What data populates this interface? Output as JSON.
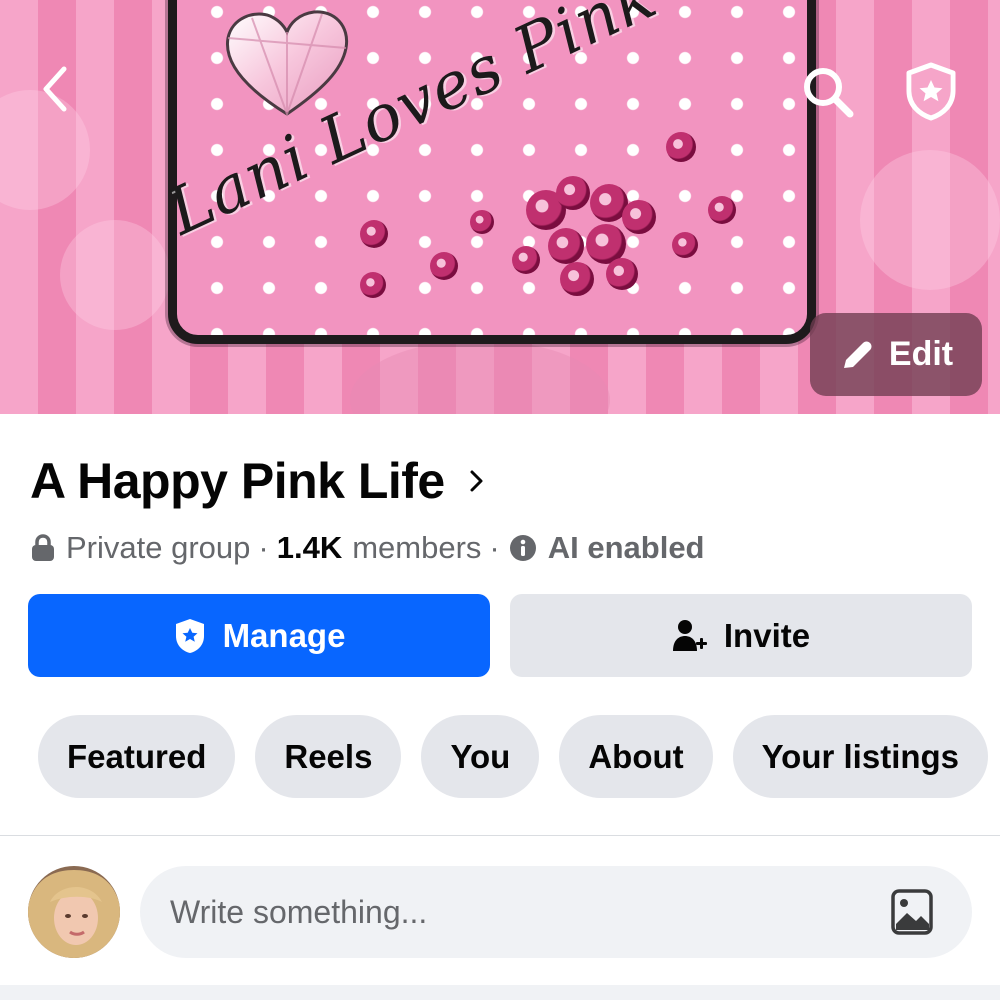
{
  "cover": {
    "artwork_text": "Lani Loves Pink",
    "edit_label": "Edit"
  },
  "icons": {
    "back": "chevron-left-icon",
    "search": "search-icon",
    "admin": "shield-star-icon",
    "edit": "pencil-icon",
    "lock": "lock-icon",
    "info": "info-icon",
    "add_person": "add-person-icon",
    "photo": "photo-icon"
  },
  "group": {
    "name": "A Happy Pink Life",
    "privacy": "Private group",
    "separator": "·",
    "member_count": "1.4K",
    "members_label": "members",
    "ai_status": "AI enabled"
  },
  "actions": {
    "manage_label": "Manage",
    "invite_label": "Invite"
  },
  "tabs": [
    {
      "label": "Featured"
    },
    {
      "label": "Reels"
    },
    {
      "label": "You"
    },
    {
      "label": "About"
    },
    {
      "label": "Your listings"
    }
  ],
  "composer": {
    "placeholder": "Write something..."
  },
  "colors": {
    "primary": "#0866ff",
    "secondary_button": "#e4e6eb",
    "text_primary": "#050505",
    "text_secondary": "#65676b",
    "cover_pink": "#f294c0"
  }
}
